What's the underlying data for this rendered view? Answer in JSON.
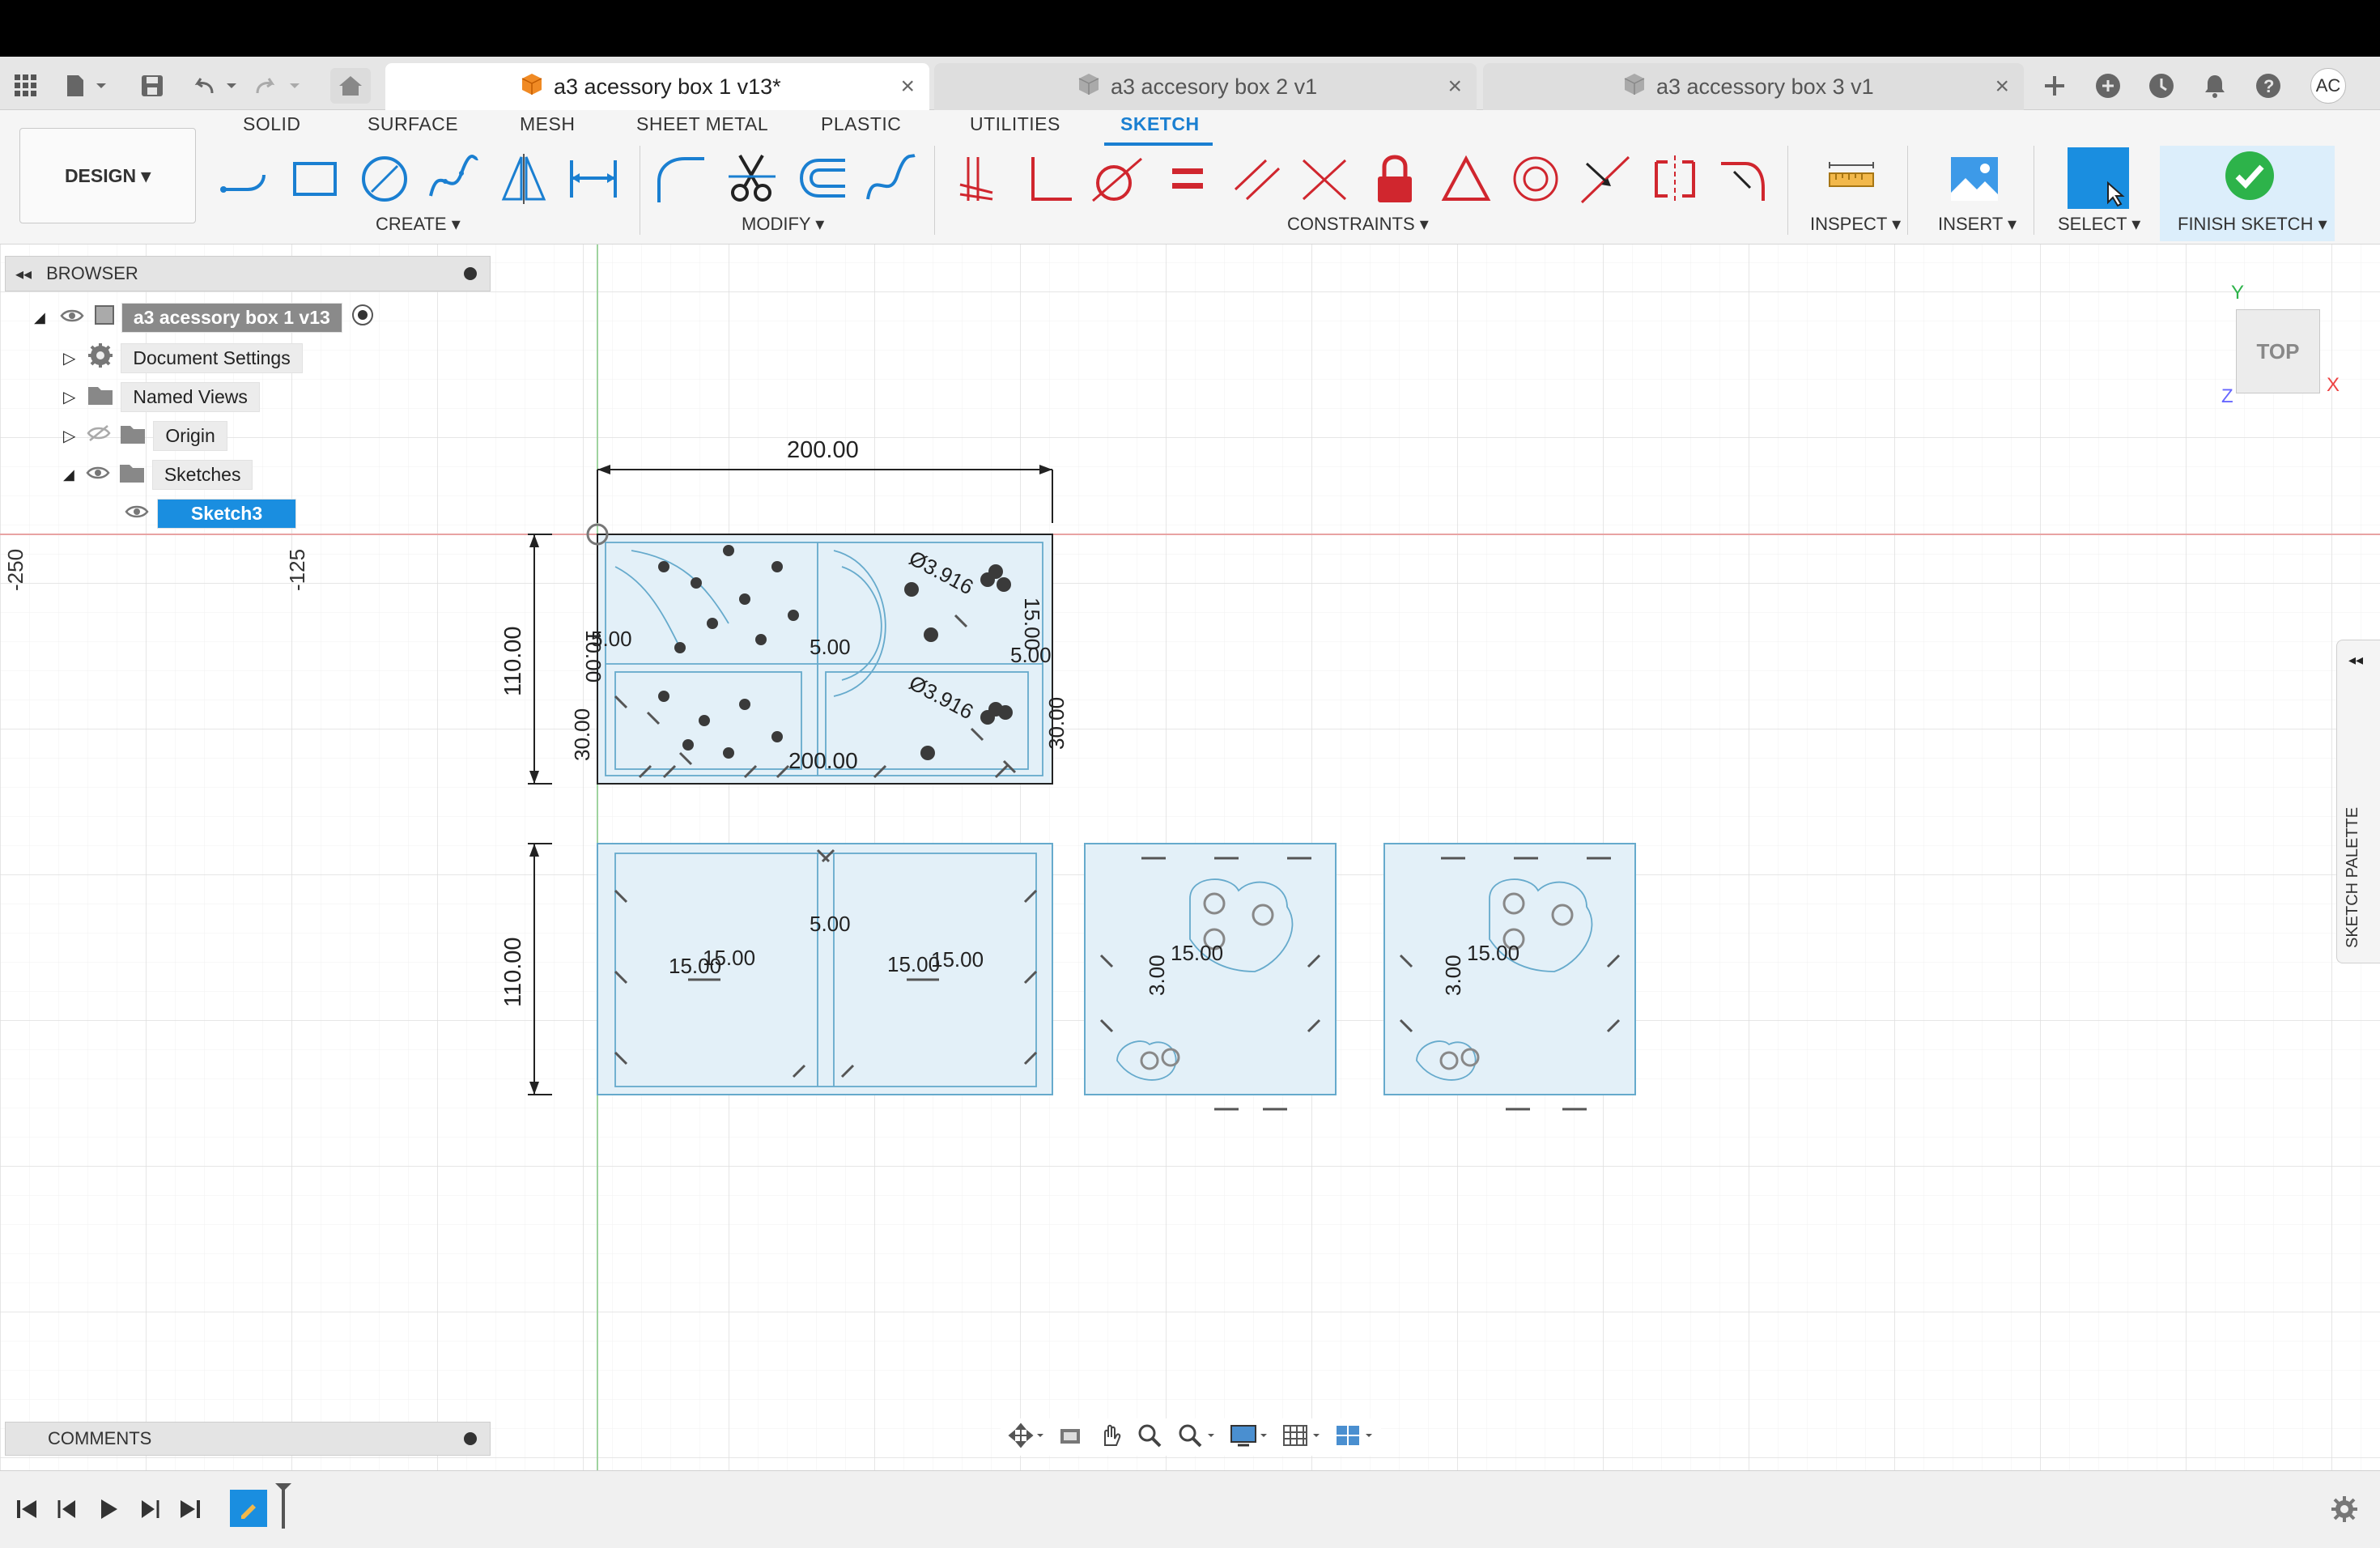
{
  "tabs": [
    {
      "label": "a3 acessory box 1 v13*",
      "active": true
    },
    {
      "label": "a3 accesory box 2 v1",
      "active": false
    },
    {
      "label": "a3 accessory box 3 v1",
      "active": false
    }
  ],
  "user_initials": "AC",
  "workspace": "DESIGN",
  "ribbon_tabs": [
    "SOLID",
    "SURFACE",
    "MESH",
    "SHEET METAL",
    "PLASTIC",
    "UTILITIES",
    "SKETCH"
  ],
  "groups": {
    "create": "CREATE",
    "modify": "MODIFY",
    "constraints": "CONSTRAINTS",
    "inspect": "INSPECT",
    "insert": "INSERT",
    "select": "SELECT",
    "finish": "FINISH SKETCH"
  },
  "browser": {
    "title": "BROWSER",
    "root": "a3 acessory box 1 v13",
    "items": [
      "Document Settings",
      "Named Views",
      "Origin",
      "Sketches"
    ],
    "sketch": "Sketch3"
  },
  "comments": "COMMENTS",
  "rulers": {
    "a": "-250",
    "b": "-125"
  },
  "viewcube": {
    "face": "TOP",
    "y": "Y",
    "x": "X",
    "z": "Z"
  },
  "palette": "SKETCH PALETTE",
  "dims": {
    "width_top": "200.00",
    "height_top": "110.00",
    "height_bottom": "110.00",
    "width_inner": "200.00",
    "d1": "5.00",
    "d2": "5.00",
    "d3": "5.00",
    "d4": "15.00",
    "d5": "15.00",
    "d6": "15.00",
    "d7": "15.00",
    "d8": "15.00",
    "d9": "15.00",
    "dia1": "Ø3.916",
    "dia2": "Ø3.916",
    "v1": "30.00",
    "v2": "30.00",
    "v3": "3.00",
    "v4": "3.00",
    "v5": "10.00",
    "v6": "15.00"
  },
  "colors": {
    "accent": "#1a8ee0",
    "sketch_fill": "#e3f0f8",
    "sketch_line": "#66aacc",
    "constraint": "#d0262e",
    "finish": "#2db34a"
  }
}
